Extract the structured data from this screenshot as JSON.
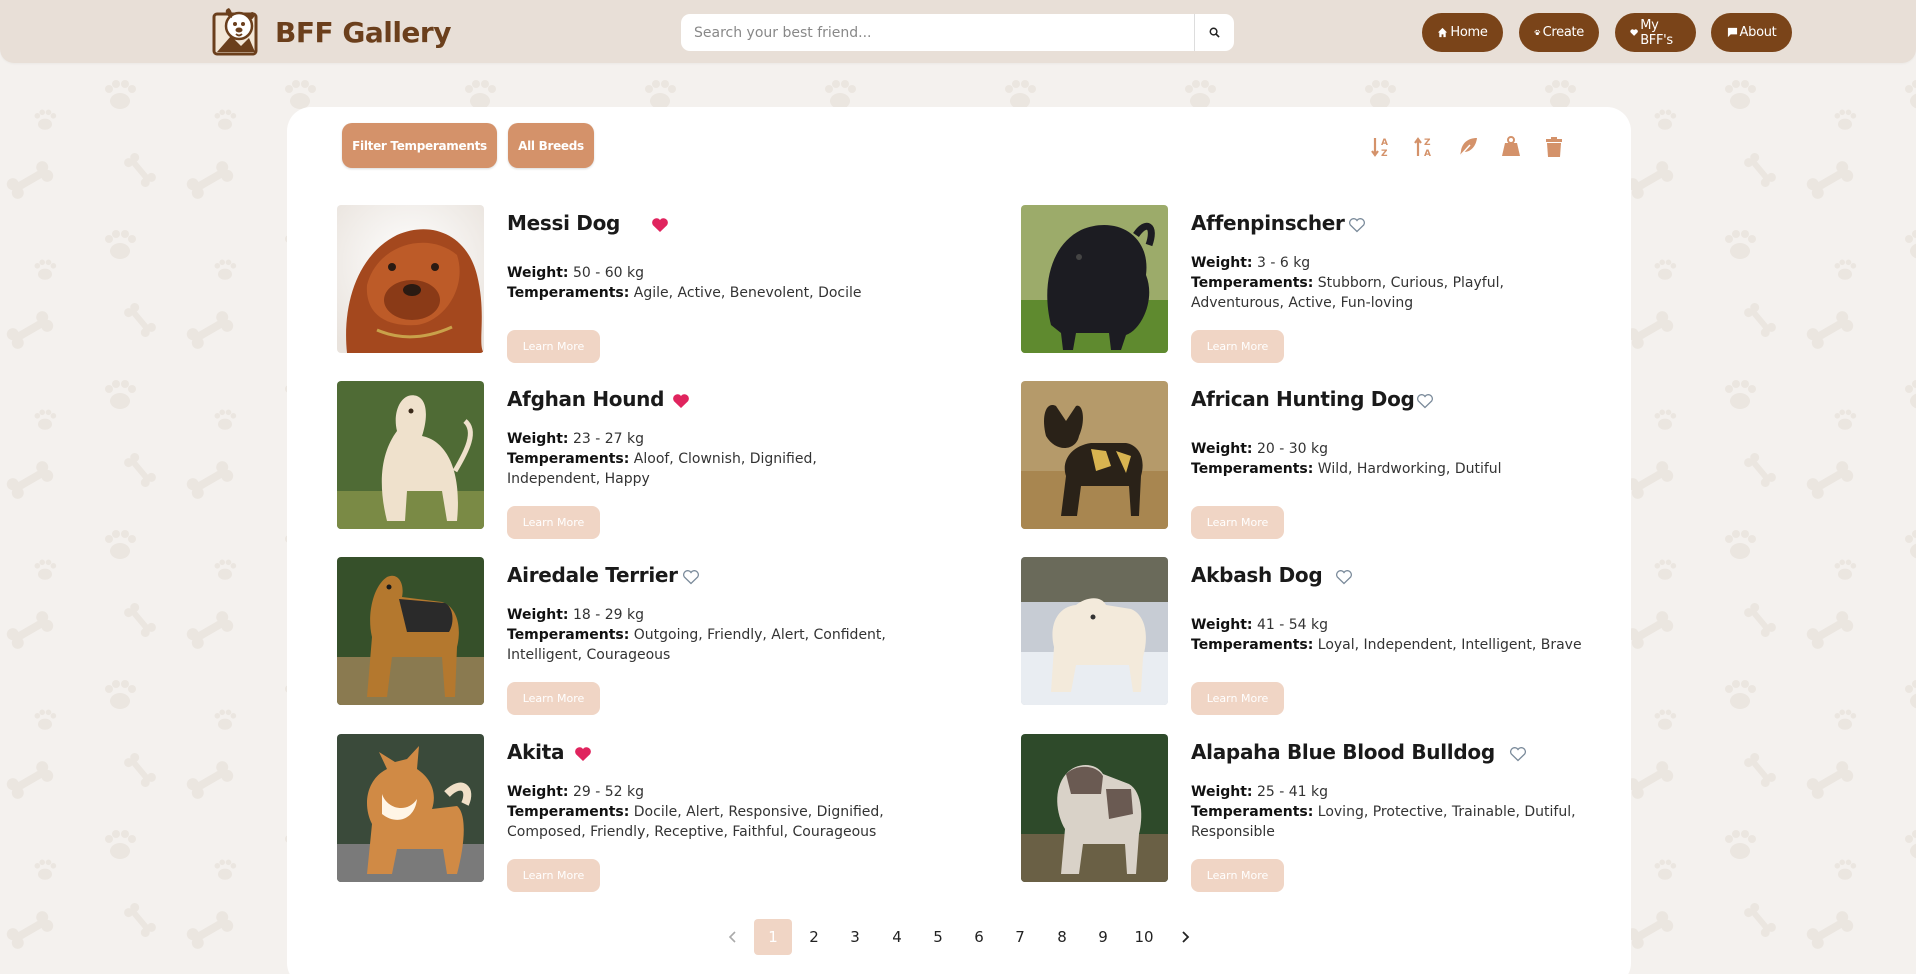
{
  "app": {
    "title": "BFF Gallery",
    "search_placeholder": "Search your best friend...",
    "nav": [
      {
        "label": "Home",
        "icon": "home-icon"
      },
      {
        "label": "Create",
        "icon": "paw-icon"
      },
      {
        "label": "My BFF's",
        "icon": "heart-icon"
      },
      {
        "label": "About",
        "icon": "chat-icon"
      }
    ]
  },
  "toolbar": {
    "filter_label": "Filter Temperaments",
    "breeds_label": "All Breeds",
    "icons": [
      "sort-az-icon",
      "sort-za-icon",
      "feather-icon",
      "weight-icon",
      "trash-icon"
    ]
  },
  "colors": {
    "brand": "#6b3f1c",
    "nav": "#7a4419",
    "accent": "#d4926a",
    "accent_light": "#f0d5c5",
    "heart_filled": "#e0245e"
  },
  "learn_more": "Learn More",
  "labels": {
    "weight": "Weight:",
    "temperaments": "Temperaments:"
  },
  "cards": [
    {
      "name": "Messi Dog",
      "favorite": true,
      "weight": "50 - 60 kg",
      "temperaments": "Agile, Active, Benevolent, Docile"
    },
    {
      "name": "Affenpinscher",
      "favorite": false,
      "weight": "3 - 6 kg",
      "temperaments": "Stubborn, Curious, Playful, Adventurous, Active, Fun-loving"
    },
    {
      "name": "Afghan Hound",
      "favorite": true,
      "weight": "23 - 27 kg",
      "temperaments": "Aloof, Clownish, Dignified, Independent, Happy"
    },
    {
      "name": "African Hunting Dog",
      "favorite": false,
      "weight": "20 - 30 kg",
      "temperaments": "Wild, Hardworking, Dutiful"
    },
    {
      "name": "Airedale Terrier",
      "favorite": false,
      "weight": "18 - 29 kg",
      "temperaments": "Outgoing, Friendly, Alert, Confident, Intelligent, Courageous"
    },
    {
      "name": "Akbash Dog",
      "favorite": false,
      "weight": "41 - 54 kg",
      "temperaments": "Loyal, Independent, Intelligent, Brave"
    },
    {
      "name": "Akita",
      "favorite": true,
      "weight": "29 - 52 kg",
      "temperaments": "Docile, Alert, Responsive, Dignified, Composed, Friendly, Receptive, Faithful, Courageous"
    },
    {
      "name": "Alapaha Blue Blood Bulldog",
      "favorite": false,
      "weight": "25 - 41 kg",
      "temperaments": "Loving, Protective, Trainable, Dutiful, Responsible"
    }
  ],
  "pagination": {
    "pages": [
      "1",
      "2",
      "3",
      "4",
      "5",
      "6",
      "7",
      "8",
      "9",
      "10"
    ],
    "current": 1
  }
}
